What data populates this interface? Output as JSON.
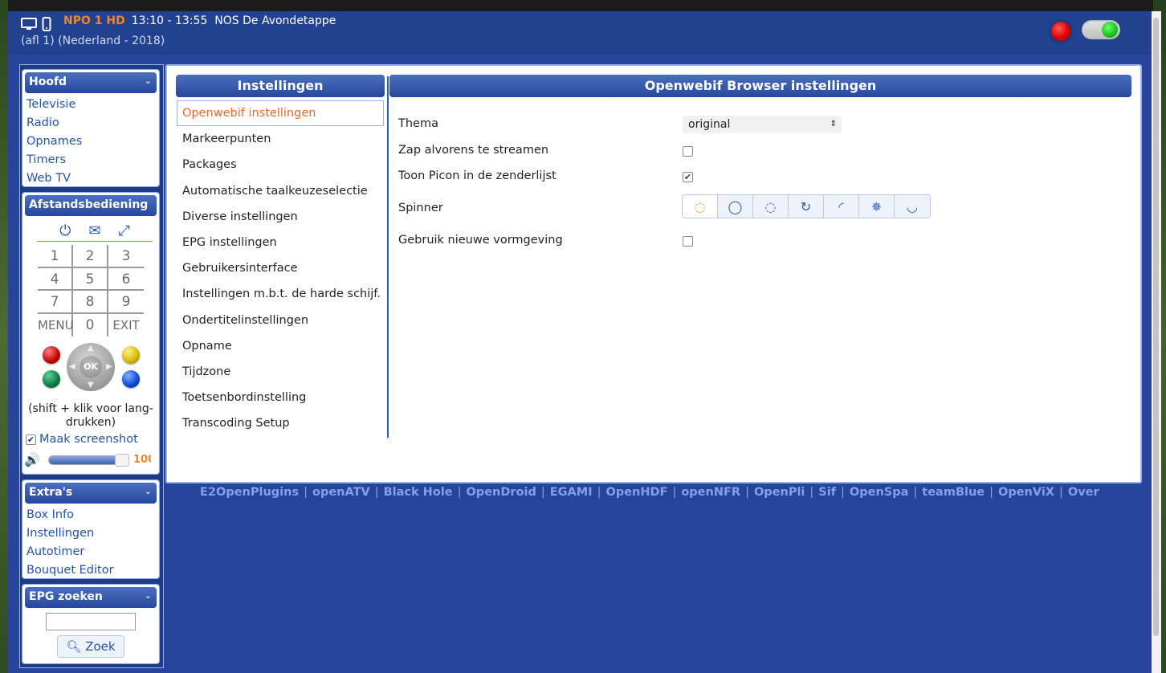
{
  "header": {
    "channel": "NPO 1 HD",
    "time": "13:10 - 13:55",
    "program": "NOS De Avondetappe",
    "subline": "(afl 1) (Nederland - 2018)",
    "icons": [
      "tv-icon",
      "phone-icon"
    ]
  },
  "left": {
    "main_box": {
      "title": "Hoofd",
      "items": [
        "Televisie",
        "Radio",
        "Opnames",
        "Timers",
        "Web TV"
      ]
    },
    "remote": {
      "title": "Afstandsbediening",
      "icons": [
        "power-icon",
        "message-icon",
        "fullscreen-icon"
      ],
      "keys": [
        "1",
        "2",
        "3",
        "4",
        "5",
        "6",
        "7",
        "8",
        "9",
        "MENU",
        "0",
        "EXIT"
      ],
      "ok": "OK",
      "hint": "(shift + klik voor lang-drukken)",
      "screenshot_label": "Maak screenshot",
      "screenshot_checked": true,
      "volume": 100,
      "volume_text": "100"
    },
    "extras": {
      "title": "Extra's",
      "items": [
        "Box Info",
        "Instellingen",
        "Autotimer",
        "Bouquet Editor"
      ]
    },
    "epg": {
      "title": "EPG zoeken",
      "search_value": "",
      "button": "Zoek"
    }
  },
  "settings": {
    "title": "Instellingen",
    "items": [
      "Openwebif instellingen",
      "Markeerpunten",
      "Packages",
      "Automatische taalkeuzeselectie",
      "Diverse instellingen",
      "EPG instellingen",
      "Gebruikersinterface",
      "Instellingen m.b.t. de harde schijf.",
      "Ondertitelinstellingen",
      "Opname",
      "Tijdzone",
      "Toetsenbordinstelling",
      "Transcoding Setup"
    ],
    "active_index": 0
  },
  "browser": {
    "title": "Openwebif Browser instellingen",
    "thema_label": "Thema",
    "thema_value": "original",
    "zap_label": "Zap alvorens te streamen",
    "zap_checked": false,
    "picon_label": "Toon Picon in de zenderlijst",
    "picon_checked": true,
    "spinner_label": "Spinner",
    "spinner_count": 7,
    "spinner_active": 0,
    "vormgeving_label": "Gebruik nieuwe vormgeving",
    "vormgeving_checked": false
  },
  "footer_links": [
    "E2OpenPlugins",
    "openATV",
    "Black Hole",
    "OpenDroid",
    "EGAMI",
    "OpenHDF",
    "openNFR",
    "OpenPli",
    "Sif",
    "OpenSpa",
    "teamBlue",
    "OpenViX",
    "Over"
  ],
  "colors": {
    "app_bg": "#25449a",
    "accent": "#f0832d",
    "link": "#2353a8",
    "footer_link": "#7fa3e8"
  }
}
